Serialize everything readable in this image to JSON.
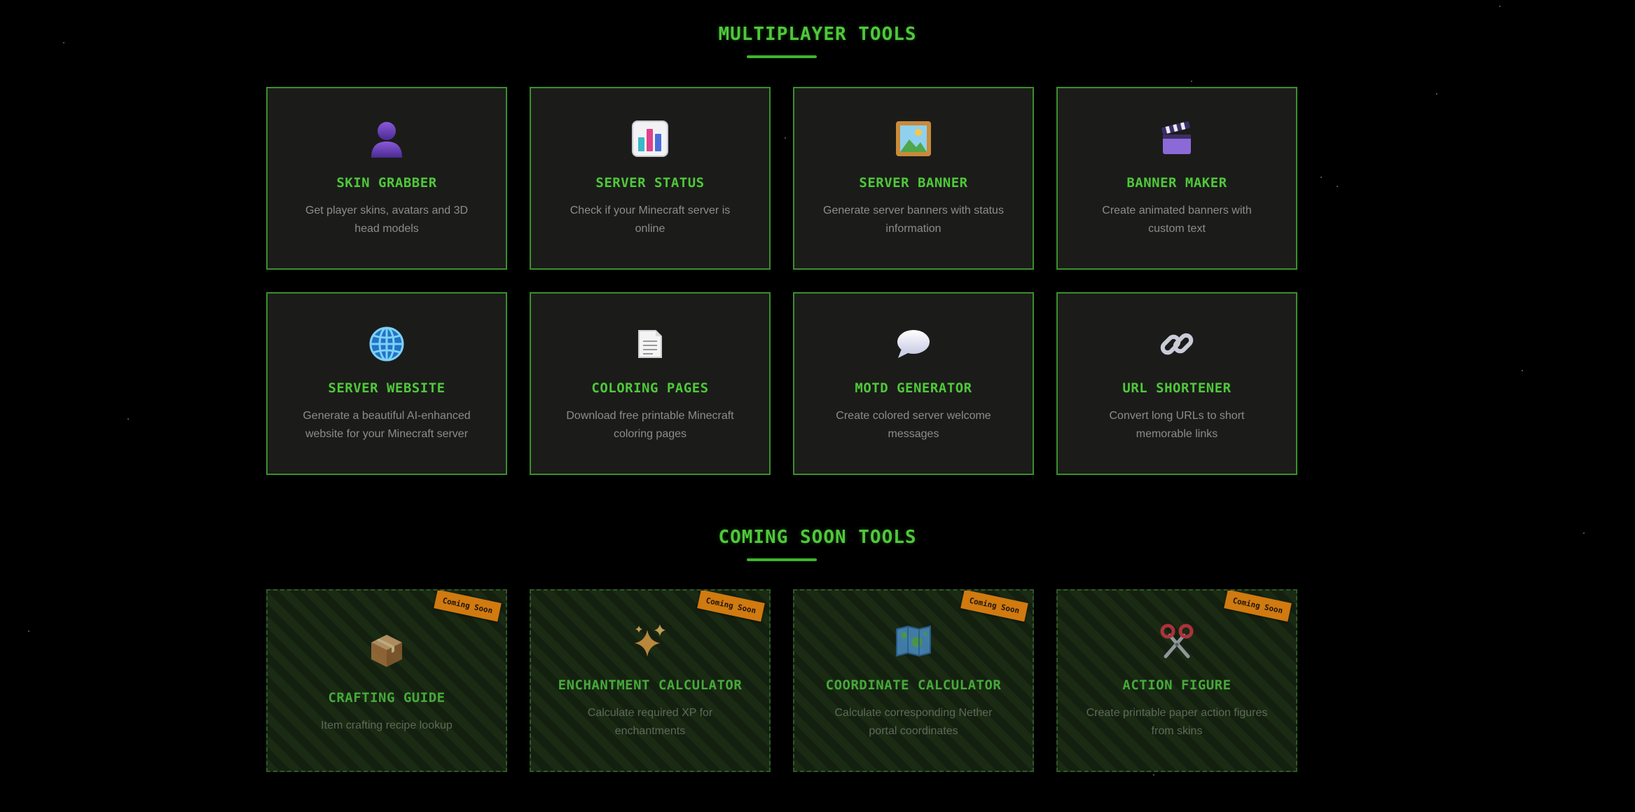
{
  "sections": [
    {
      "title": "MULTIPLAYER TOOLS",
      "tools": [
        {
          "name": "SKIN GRABBER",
          "description": "Get player skins, avatars and 3D head models",
          "icon": "person-icon"
        },
        {
          "name": "SERVER STATUS",
          "description": "Check if your Minecraft server is online",
          "icon": "bar-chart-icon"
        },
        {
          "name": "SERVER BANNER",
          "description": "Generate server banners with status information",
          "icon": "picture-icon"
        },
        {
          "name": "BANNER MAKER",
          "description": "Create animated banners with custom text",
          "icon": "clapperboard-icon"
        },
        {
          "name": "SERVER WEBSITE",
          "description": "Generate a beautiful AI-enhanced website for your Minecraft server",
          "icon": "globe-icon"
        },
        {
          "name": "COLORING PAGES",
          "description": "Download free printable Minecraft coloring pages",
          "icon": "document-icon"
        },
        {
          "name": "MOTD GENERATOR",
          "description": "Create colored server welcome messages",
          "icon": "speech-bubble-icon"
        },
        {
          "name": "URL SHORTENER",
          "description": "Convert long URLs to short memorable links",
          "icon": "link-icon"
        }
      ]
    },
    {
      "title": "COMING SOON TOOLS",
      "badge_label": "Coming Soon",
      "tools": [
        {
          "name": "CRAFTING GUIDE",
          "description": "Item crafting recipe lookup",
          "icon": "package-icon"
        },
        {
          "name": "ENCHANTMENT CALCULATOR",
          "description": "Calculate required XP for enchantments",
          "icon": "sparkles-icon"
        },
        {
          "name": "COORDINATE CALCULATOR",
          "description": "Calculate corresponding Nether portal coordinates",
          "icon": "world-map-icon"
        },
        {
          "name": "ACTION FIGURE",
          "description": "Create printable paper action figures from skins",
          "icon": "scissors-icon"
        }
      ]
    }
  ],
  "colors": {
    "accent_green": "#4fc83a",
    "card_border": "#3a8f2c",
    "badge_orange": "#d07a10"
  }
}
